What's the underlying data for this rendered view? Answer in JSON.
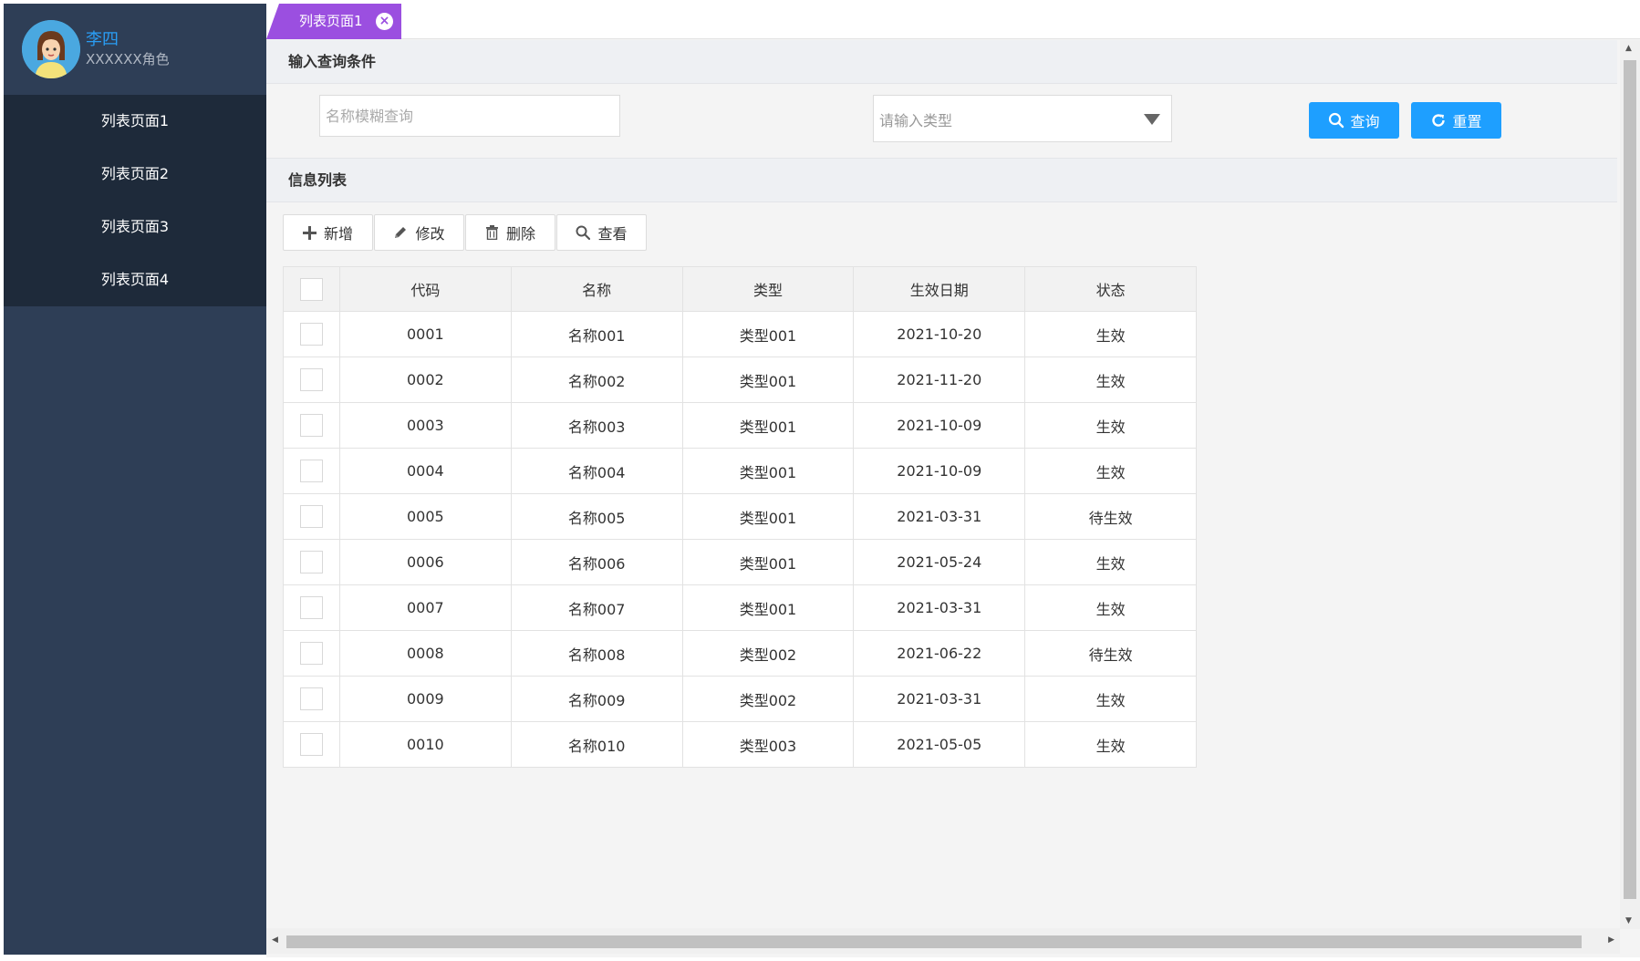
{
  "user": {
    "name": "李四",
    "role": "XXXXXX角色"
  },
  "menu": [
    {
      "label": "列表页面1"
    },
    {
      "label": "列表页面2"
    },
    {
      "label": "列表页面3"
    },
    {
      "label": "列表页面4"
    }
  ],
  "tabs": [
    {
      "label": "列表页面1",
      "close_icon": "close-circle-icon"
    }
  ],
  "query": {
    "title": "输入查询条件",
    "name_placeholder": "名称模糊查询",
    "type_placeholder": "请输入类型",
    "search_label": "查询",
    "reset_label": "重置"
  },
  "list": {
    "title": "信息列表",
    "actions": {
      "add": "新增",
      "edit": "修改",
      "delete": "删除",
      "view": "查看"
    },
    "columns": [
      "代码",
      "名称",
      "类型",
      "生效日期",
      "状态"
    ],
    "rows": [
      [
        "0001",
        "名称001",
        "类型001",
        "2021-10-20",
        "生效"
      ],
      [
        "0002",
        "名称002",
        "类型001",
        "2021-11-20",
        "生效"
      ],
      [
        "0003",
        "名称003",
        "类型001",
        "2021-10-09",
        "生效"
      ],
      [
        "0004",
        "名称004",
        "类型001",
        "2021-10-09",
        "生效"
      ],
      [
        "0005",
        "名称005",
        "类型001",
        "2021-03-31",
        "待生效"
      ],
      [
        "0006",
        "名称006",
        "类型001",
        "2021-05-24",
        "生效"
      ],
      [
        "0007",
        "名称007",
        "类型001",
        "2021-03-31",
        "生效"
      ],
      [
        "0008",
        "名称008",
        "类型002",
        "2021-06-22",
        "待生效"
      ],
      [
        "0009",
        "名称009",
        "类型002",
        "2021-03-31",
        "生效"
      ],
      [
        "0010",
        "名称010",
        "类型003",
        "2021-05-05",
        "生效"
      ]
    ]
  },
  "colors": {
    "sidebar": "#2e3e56",
    "menu": "#1e2a3a",
    "tab": "#9b4fe0",
    "primary": "#1e9fff",
    "user_name": "#2a9df4"
  }
}
